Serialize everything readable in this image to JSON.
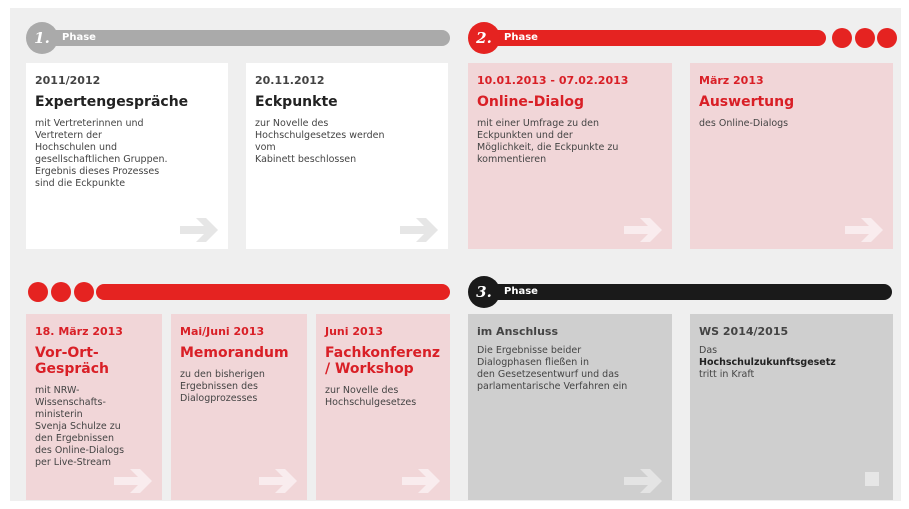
{
  "colors": {
    "red": "#e52321",
    "gray_bar": "#aaaaaa",
    "black": "#1a1a1a"
  },
  "phases": [
    {
      "number": "1.",
      "label": "Phase"
    },
    {
      "number": "2.",
      "label": "Phase"
    },
    {
      "number": "3.",
      "label": "Phase"
    }
  ],
  "cards": {
    "c1": {
      "date": "2011/2012",
      "title": "Expertengespräche",
      "text": "mit Vertreterinnen und\nVertretern der\nHochschulen und\ngesellschaftlichen Gruppen.\nErgebnis dieses Prozesses\nsind die Eckpunkte"
    },
    "c2": {
      "date": "20.11.2012",
      "title": "Eckpunkte",
      "text": "zur Novelle des\nHochschulgesetzes werden\nvom\nKabinett beschlossen"
    },
    "c3": {
      "date": "10.01.2013 - 07.02.2013",
      "title": "Online-Dialog",
      "text": "mit einer Umfrage zu den\nEckpunkten und der\nMöglichkeit, die Eckpunkte zu\nkommentieren"
    },
    "c4": {
      "date": "März 2013",
      "title": "Auswertung",
      "text": "des Online-Dialogs"
    },
    "c5": {
      "date": "18. März 2013",
      "title": "Vor-Ort-\nGespräch",
      "text": "mit NRW-\nWissenschafts-\nministerin\nSvenja Schulze zu\nden Ergebnissen\ndes Online-Dialogs\nper Live-Stream"
    },
    "c6": {
      "date": "Mai/Juni 2013",
      "title": "Memorandum",
      "text": "zu den bisherigen\nErgebnissen des\nDialogprozesses"
    },
    "c7": {
      "date": "Juni 2013",
      "title": "Fachkonferenz\n/ Workshop",
      "text": "zur Novelle des\nHochschulgesetzes"
    },
    "c8": {
      "date": "im Anschluss",
      "title": "",
      "text": "Die Ergebnisse beider\nDialogphasen fließen in\nden Gesetzesentwurf und das\nparlamentarische Verfahren ein"
    },
    "c9": {
      "date": "WS 2014/2015",
      "title": "",
      "text_before": "Das",
      "text_bold": "Hochschulzukunftsgesetz",
      "text_after": "tritt in Kraft"
    }
  }
}
